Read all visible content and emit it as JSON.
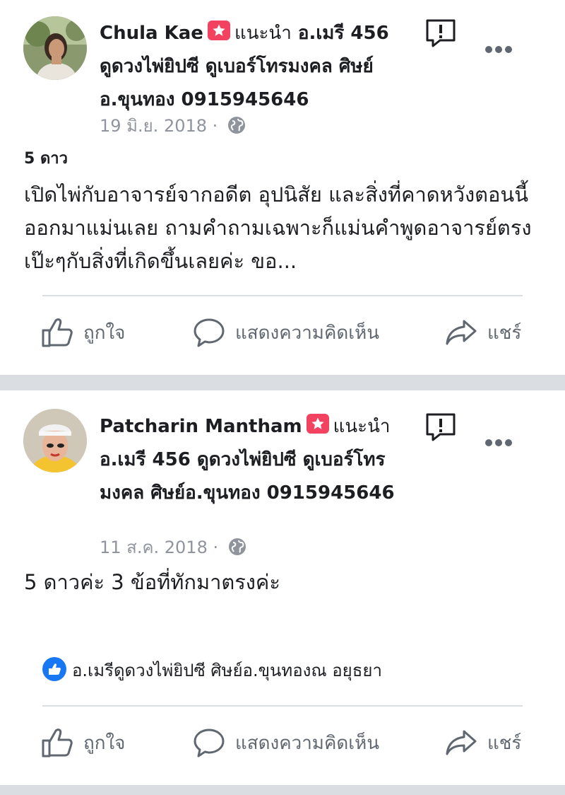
{
  "posts": [
    {
      "author": "Chula Kae",
      "recommends_label": "แนะนำ",
      "page_name": "อ.เมรี 456 ดูดวงไพ่ยิปซี ดูเบอร์โทรมงคล ศิษย์อ.ขุนทอง 0915945646",
      "date": "19 มิ.ย. 2018",
      "separator": "·",
      "rating_label": "5 ดาว",
      "review_text": "เปิดไพ่กับอาจารย์จากอดีต อุปนิสัย และสิ่งที่คาดหวังตอนนี้ ออกมาแม่นเลย ถามคำถามเฉพาะก็แม่นคำพูดอาจารย์ตรงเป๊ะๆกับสิ่งที่เกิดขึ้นเลยค่ะ ขอ..."
    },
    {
      "author": "Patcharin Mantham",
      "recommends_label": "แนะนำ",
      "page_name": "อ.เมรี 456 ดูดวงไพ่ยิปซี ดูเบอร์โทรมงคล ศิษย์อ.ขุนทอง 0915945646",
      "date": "11 ส.ค. 2018",
      "separator": "·",
      "review_text": "5 ดาวค่ะ 3 ข้อที่ทักมาตรงค่ะ",
      "reaction_names": "อ.เมรีดูดวงไพ่ยิปซี ศิษย์อ.ขุนทองณ อยุธยา"
    }
  ],
  "actions": {
    "like": "ถูกใจ",
    "comment": "แสดงความคิดเห็น",
    "share": "แชร์"
  },
  "icons": {
    "report": "report-flag-icon",
    "more": "more-options-icon",
    "globe": "globe-icon",
    "recommend": "recommend-star-icon",
    "like": "thumbs-up-icon",
    "comment": "comment-bubble-icon",
    "share": "share-arrow-icon"
  },
  "colors": {
    "recommend_badge": "#f3425f",
    "like_badge": "#1877f2",
    "muted_text": "#90949c",
    "action_text": "#606770",
    "separator": "#dadde1"
  }
}
